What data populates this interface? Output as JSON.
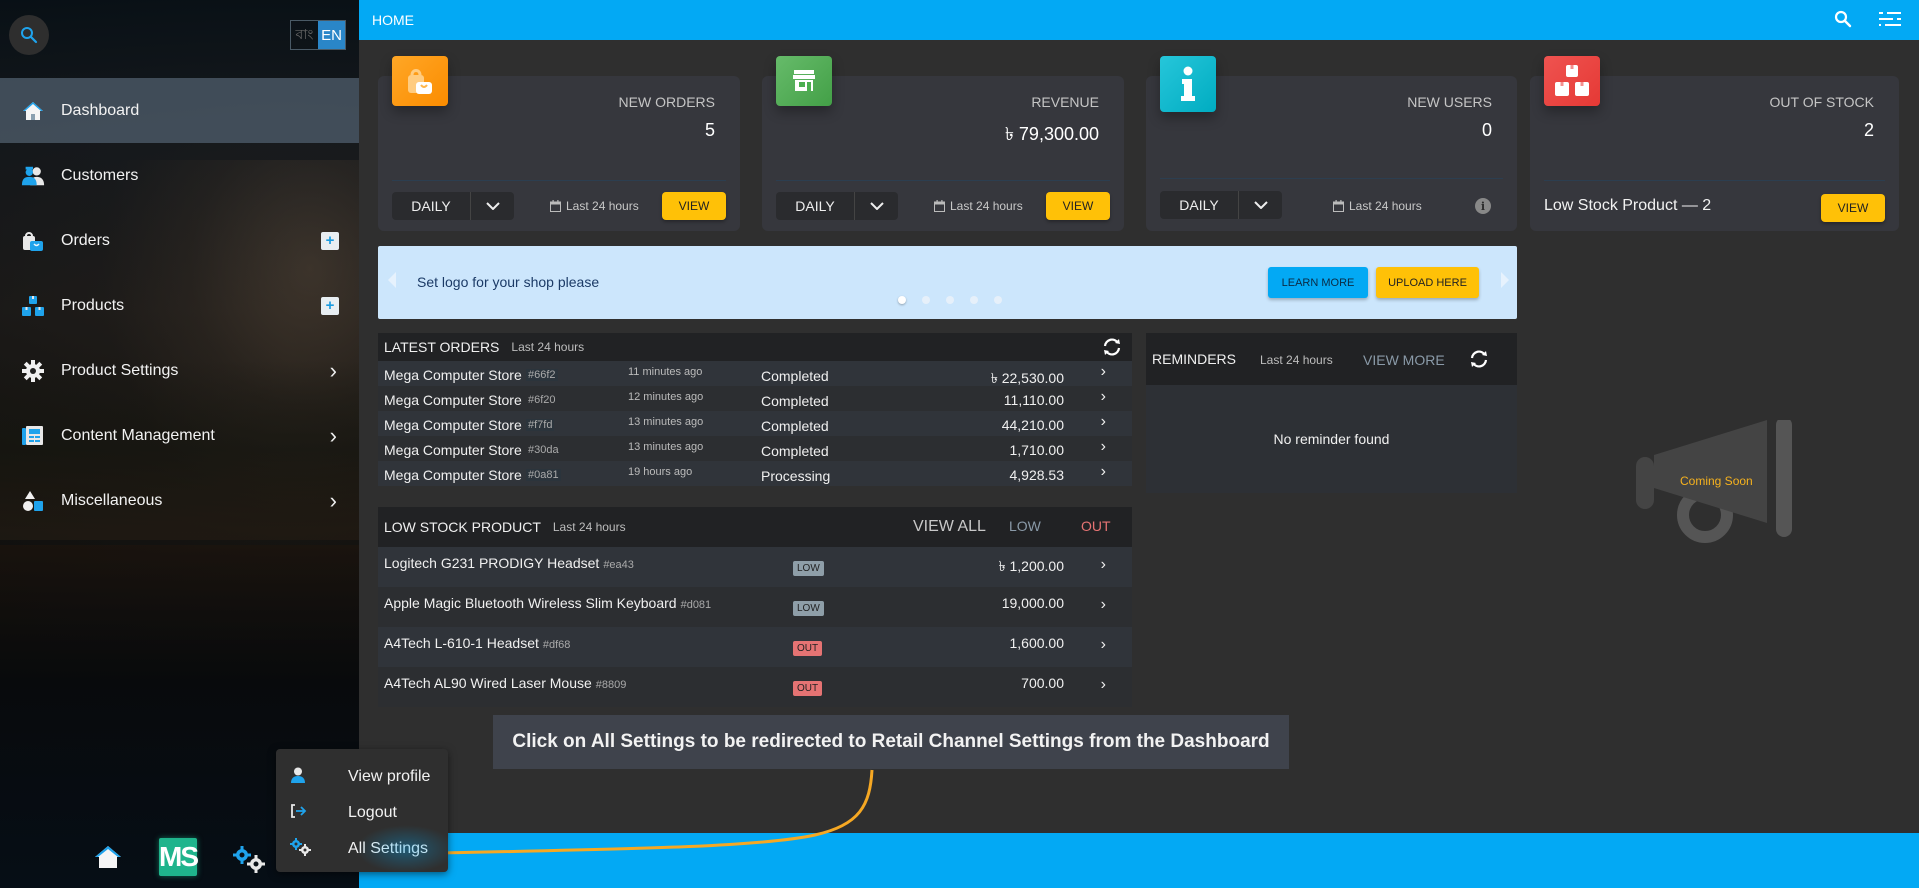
{
  "sidebar": {
    "language": {
      "bn": "বাং",
      "en": "EN",
      "active": "EN"
    },
    "items": [
      {
        "label": "Dashboard",
        "icon": "home-icon",
        "active": true
      },
      {
        "label": "Customers",
        "icon": "users-icon"
      },
      {
        "label": "Orders",
        "icon": "shopping-bag-icon",
        "action": "plus"
      },
      {
        "label": "Products",
        "icon": "boxes-icon",
        "action": "plus"
      },
      {
        "label": "Product Settings",
        "icon": "gear-icon",
        "action": "chevron"
      },
      {
        "label": "Content Management",
        "icon": "newspaper-icon",
        "action": "chevron"
      },
      {
        "label": "Miscellaneous",
        "icon": "shapes-icon",
        "action": "chevron"
      }
    ],
    "bottom": {
      "logo_text": "MS"
    }
  },
  "topbar": {
    "title": "HOME"
  },
  "cards": [
    {
      "title": "NEW ORDERS",
      "value": "5",
      "period": "DAILY",
      "range": "Last 24 hours",
      "button": "VIEW",
      "color": "#ff9800"
    },
    {
      "title": "REVENUE",
      "value": "৳ 79,300.00",
      "period": "DAILY",
      "range": "Last 24 hours",
      "button": "VIEW",
      "color": "#4caf50"
    },
    {
      "title": "NEW USERS",
      "value": "0",
      "period": "DAILY",
      "range": "Last 24 hours",
      "color": "#00bcd4"
    },
    {
      "title": "OUT OF STOCK",
      "value": "2",
      "footer": "Low Stock Product — 2",
      "button": "VIEW",
      "color": "#e53935"
    }
  ],
  "banner": {
    "message": "Set logo for your shop please",
    "learn_more": "LEARN MORE",
    "upload": "UPLOAD HERE",
    "slide_count": 5,
    "active_slide": 1
  },
  "latest_orders": {
    "title": "LATEST ORDERS",
    "subtitle": "Last 24 hours",
    "rows": [
      {
        "store": "Mega Computer Store",
        "id": "#66f2",
        "time": "11 minutes ago",
        "status": "Completed",
        "amount": "৳ 22,530.00"
      },
      {
        "store": "Mega Computer Store",
        "id": "#6f20",
        "time": "12 minutes ago",
        "status": "Completed",
        "amount": "11,110.00"
      },
      {
        "store": "Mega Computer Store",
        "id": "#f7fd",
        "time": "13 minutes ago",
        "status": "Completed",
        "amount": "44,210.00"
      },
      {
        "store": "Mega Computer Store",
        "id": "#30da",
        "time": "13 minutes ago",
        "status": "Completed",
        "amount": "1,710.00"
      },
      {
        "store": "Mega Computer Store",
        "id": "#0a81",
        "time": "19 hours ago",
        "status": "Processing",
        "amount": "4,928.53"
      }
    ]
  },
  "low_stock": {
    "title": "LOW STOCK PRODUCT",
    "subtitle": "Last 24 hours",
    "view_all": "VIEW ALL",
    "tab_low": "LOW",
    "tab_out": "OUT",
    "rows": [
      {
        "name": "Logitech G231 PRODIGY Headset",
        "id": "#ea43",
        "badge": "LOW",
        "amount": "৳ 1,200.00"
      },
      {
        "name": "Apple Magic Bluetooth Wireless Slim Keyboard",
        "id": "#d081",
        "badge": "LOW",
        "amount": "19,000.00"
      },
      {
        "name": "A4Tech L-610-1 Headset",
        "id": "#df68",
        "badge": "OUT",
        "amount": "1,600.00"
      },
      {
        "name": "A4Tech AL90 Wired Laser Mouse",
        "id": "#8809",
        "badge": "OUT",
        "amount": "700.00"
      }
    ]
  },
  "reminders": {
    "title": "REMINDERS",
    "subtitle": "Last 24 hours",
    "view_more": "VIEW MORE",
    "empty": "No reminder found"
  },
  "coming_soon": "Coming Soon",
  "user_menu": {
    "items": [
      {
        "label": "View profile",
        "icon": "user-icon"
      },
      {
        "label": "Logout",
        "icon": "logout-icon"
      },
      {
        "label": "All Settings",
        "icon": "gears-icon"
      }
    ]
  },
  "callout": "Click on All Settings to be redirected to Retail Channel Settings from the Dashboard",
  "colors": {
    "accent": "#03a9f4",
    "warning": "#ffc107"
  }
}
